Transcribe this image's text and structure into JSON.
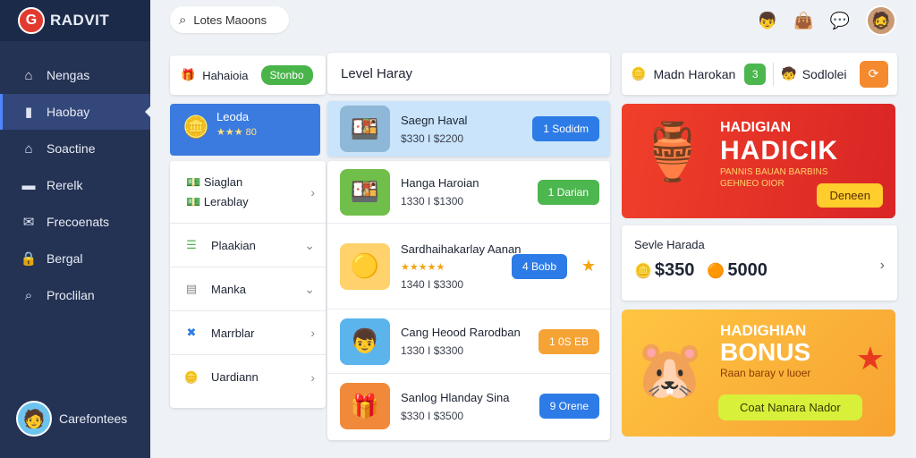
{
  "brand": {
    "logo_letter": "G",
    "name": "RADVIT"
  },
  "search": {
    "text": "Lotes Maoons"
  },
  "sidebar": {
    "items": [
      {
        "label": "Nengas",
        "icon": "home-icon",
        "glyph": "⌂"
      },
      {
        "label": "Haobay",
        "icon": "bookmark-icon",
        "glyph": "▮"
      },
      {
        "label": "Soactine",
        "icon": "home-icon",
        "glyph": "⌂"
      },
      {
        "label": "Rerelk",
        "icon": "folder-icon",
        "glyph": "▬"
      },
      {
        "label": "Frecoenats",
        "icon": "mail-icon",
        "glyph": "✉"
      },
      {
        "label": "Bergal",
        "icon": "lock-icon",
        "glyph": "🔒"
      },
      {
        "label": "Proclilan",
        "icon": "search-icon",
        "glyph": "⌕"
      }
    ],
    "profile_name": "Carefontees"
  },
  "col1": {
    "top_label": "Hahaioia",
    "top_pill": "Stonbo",
    "highlight_name": "Leoda",
    "highlight_stars": "★★★ 80",
    "list": [
      {
        "line1": "Siaglan",
        "line2": "Lerablay"
      },
      {
        "label": "Plaakian"
      },
      {
        "label": "Manka"
      },
      {
        "label": "Marrblar"
      },
      {
        "label": "Uardiann"
      }
    ]
  },
  "col2": {
    "header": "Level Haray",
    "items": [
      {
        "title": "Saegn Haval",
        "price": "$330 I $2200",
        "button": "1 Sodidm"
      },
      {
        "title": "Hanga Haroian",
        "price": "1330 I $1300",
        "button": "1 Darian"
      },
      {
        "title": "Sardhaihakarlay Aanan",
        "stars": "★★★★★",
        "price": "1340 I $3300",
        "button": "4 Bobb"
      },
      {
        "title": "Cang Heood Rarodban",
        "price": "1330 I $3300",
        "button": "1 0S EB"
      },
      {
        "title": "Sanlog Hlanday Sina",
        "price": "$330 I $3500",
        "button": "9 Orene"
      }
    ]
  },
  "col3": {
    "top_label": "Madn Harokan",
    "top_badge": "3",
    "top_label2": "Sodlolei",
    "promo1": {
      "heading": "HADIGIAN",
      "title": "HADICIK",
      "sub": "PANNIS BAUAN BARBINS GEHNEO OIOR",
      "cta": "Deneen"
    },
    "stat": {
      "label": "Sevle Harada",
      "value1": "$350",
      "value2": "5000"
    },
    "promo2": {
      "heading": "HADIGHIAN",
      "title": "BONUS",
      "sub": "Raan baray v luoer",
      "cta": "Coat Nanara Nador"
    }
  }
}
